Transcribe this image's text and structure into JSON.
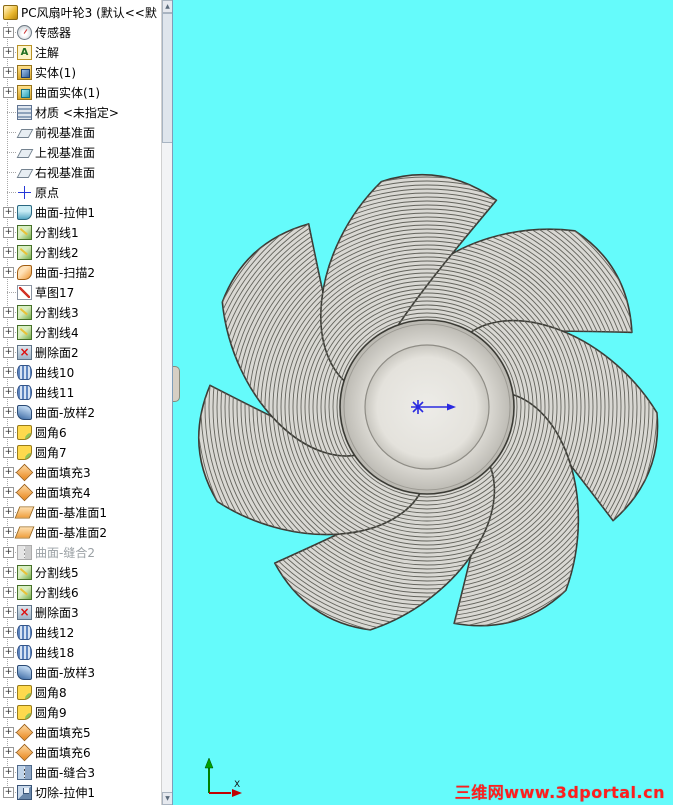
{
  "feature_tree": {
    "root": {
      "label": "PC风扇叶轮3 (默认<<默",
      "icon": "part"
    },
    "items": [
      {
        "label": "传感器",
        "icon": "sensors-folder",
        "plus": true
      },
      {
        "label": "注解",
        "icon": "annotations-folder",
        "plus": true
      },
      {
        "label": "实体(1)",
        "icon": "solid-bodies-folder",
        "plus": true
      },
      {
        "label": "曲面实体(1)",
        "icon": "surface-bodies-folder",
        "plus": true
      },
      {
        "label": "材质 <未指定>",
        "icon": "material",
        "plus": false
      },
      {
        "label": "前视基准面",
        "icon": "plane",
        "plus": false
      },
      {
        "label": "上视基准面",
        "icon": "plane",
        "plus": false
      },
      {
        "label": "右视基准面",
        "icon": "plane",
        "plus": false
      },
      {
        "label": "原点",
        "icon": "origin",
        "plus": false
      },
      {
        "label": "曲面-拉伸1",
        "icon": "surface-extrude",
        "plus": true
      },
      {
        "label": "分割线1",
        "icon": "split-line",
        "plus": true
      },
      {
        "label": "分割线2",
        "icon": "split-line",
        "plus": true
      },
      {
        "label": "曲面-扫描2",
        "icon": "surface-sweep",
        "plus": true
      },
      {
        "label": "草图17",
        "icon": "sketch",
        "plus": false
      },
      {
        "label": "分割线3",
        "icon": "split-line",
        "plus": true
      },
      {
        "label": "分割线4",
        "icon": "split-line",
        "plus": true
      },
      {
        "label": "删除面2",
        "icon": "delete-face",
        "plus": true
      },
      {
        "label": "曲线10",
        "icon": "curve",
        "plus": true
      },
      {
        "label": "曲线11",
        "icon": "curve",
        "plus": true
      },
      {
        "label": "曲面-放样2",
        "icon": "surface-loft",
        "plus": true
      },
      {
        "label": "圆角6",
        "icon": "fillet",
        "plus": true
      },
      {
        "label": "圆角7",
        "icon": "fillet",
        "plus": true
      },
      {
        "label": "曲面填充3",
        "icon": "surface-fill",
        "plus": true
      },
      {
        "label": "曲面填充4",
        "icon": "surface-fill",
        "plus": true
      },
      {
        "label": "曲面-基准面1",
        "icon": "surface-plane",
        "plus": true
      },
      {
        "label": "曲面-基准面2",
        "icon": "surface-plane",
        "plus": true
      },
      {
        "label": "曲面-缝合2",
        "icon": "surface-knit",
        "plus": true,
        "suppressed": true
      },
      {
        "label": "分割线5",
        "icon": "split-line",
        "plus": true
      },
      {
        "label": "分割线6",
        "icon": "split-line",
        "plus": true
      },
      {
        "label": "删除面3",
        "icon": "delete-face",
        "plus": true
      },
      {
        "label": "曲线12",
        "icon": "curve",
        "plus": true
      },
      {
        "label": "曲线18",
        "icon": "curve",
        "plus": true
      },
      {
        "label": "曲面-放样3",
        "icon": "surface-loft",
        "plus": true
      },
      {
        "label": "圆角8",
        "icon": "fillet",
        "plus": true
      },
      {
        "label": "圆角9",
        "icon": "fillet",
        "plus": true
      },
      {
        "label": "曲面填充5",
        "icon": "surface-fill",
        "plus": true
      },
      {
        "label": "曲面填充6",
        "icon": "surface-fill",
        "plus": true
      },
      {
        "label": "曲面-缝合3",
        "icon": "surface-knit",
        "plus": true
      },
      {
        "label": "切除-拉伸1",
        "icon": "cut-extrude",
        "plus": true
      }
    ]
  },
  "viewport": {
    "background_color": "#65FBFB",
    "origin_marker_color": "#2A2AE0",
    "watermark_text": "三维网www.3dportal.cn",
    "watermark_color": "#FF1E1E",
    "triad": {
      "x_label": "X"
    }
  },
  "fan": {
    "blade_count": 7,
    "body_color": "#D9D8D3",
    "stripe_color": "#63635C",
    "outline_color": "#3B3B35",
    "hub": {
      "outer_radius": 87,
      "inner_radius": 62
    }
  }
}
